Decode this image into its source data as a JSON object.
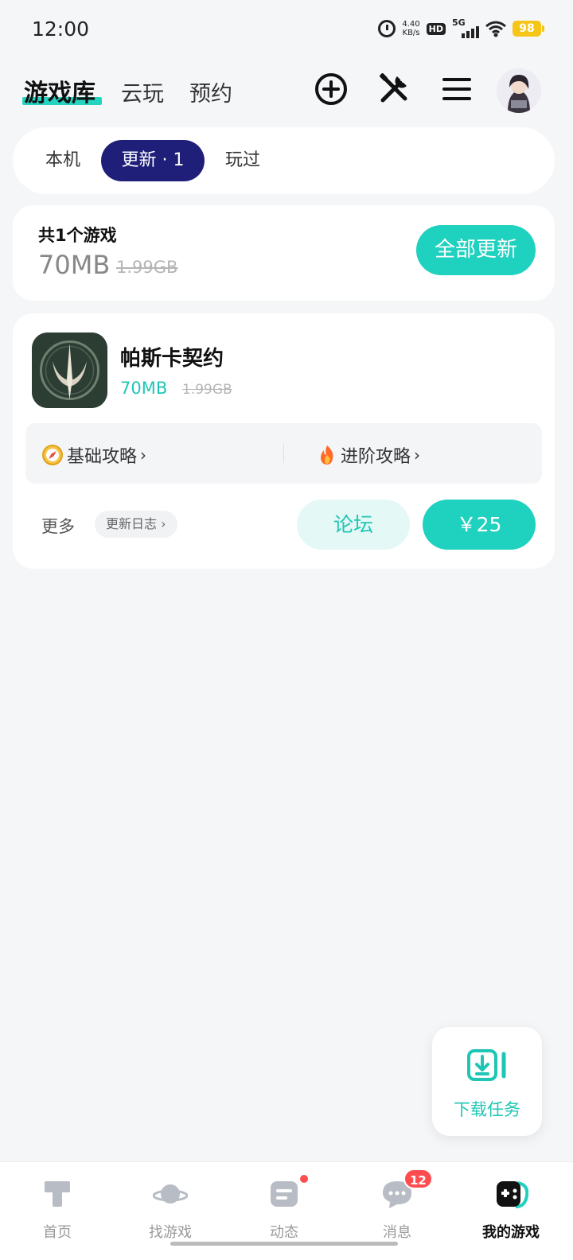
{
  "status_bar": {
    "time": "12:00",
    "net_speed_value": "4.40",
    "net_speed_unit": "KB/s",
    "hd_label": "HD",
    "network_label": "5G",
    "battery_level": "98",
    "icons": [
      "alarm-icon",
      "hd-icon",
      "signal-icon",
      "wifi-icon",
      "battery-icon"
    ]
  },
  "header": {
    "tabs": [
      {
        "label": "游戏库",
        "active": true
      },
      {
        "label": "云玩",
        "active": false
      },
      {
        "label": "预约",
        "active": false
      }
    ],
    "actions": [
      "add-icon",
      "tools-icon",
      "menu-icon"
    ],
    "avatar": "avatar"
  },
  "segments": {
    "items": [
      {
        "label": "本机",
        "active": false
      },
      {
        "label": "更新 · 1",
        "active": true
      },
      {
        "label": "玩过",
        "active": false
      }
    ]
  },
  "summary": {
    "title": "共1个游戏",
    "update_size": "70MB",
    "full_size": "1.99GB",
    "update_all_label": "全部更新"
  },
  "game": {
    "name": "帕斯卡契约",
    "update_size": "70MB",
    "full_size": "1.99GB",
    "guides": [
      {
        "icon": "compass-icon",
        "label": "基础攻略"
      },
      {
        "icon": "fire-icon",
        "label": "进阶攻略"
      }
    ],
    "more_label": "更多",
    "changelog_label": "更新日志",
    "forum_label": "论坛",
    "price_label": "￥25"
  },
  "download_float": {
    "label": "下载任务",
    "icon": "download-task-icon"
  },
  "bottom_nav": {
    "items": [
      {
        "label": "首页",
        "icon": "home-icon",
        "active": false
      },
      {
        "label": "找游戏",
        "icon": "planet-icon",
        "active": false
      },
      {
        "label": "动态",
        "icon": "feed-icon",
        "active": false,
        "dot": true
      },
      {
        "label": "消息",
        "icon": "chat-icon",
        "active": false,
        "badge": "12"
      },
      {
        "label": "我的游戏",
        "icon": "gamepad-icon",
        "active": true
      }
    ]
  },
  "colors": {
    "accent": "#1fd1bf",
    "segment_active": "#1f1f7a",
    "badge": "#ff4d4f",
    "background": "#f5f6f8"
  }
}
